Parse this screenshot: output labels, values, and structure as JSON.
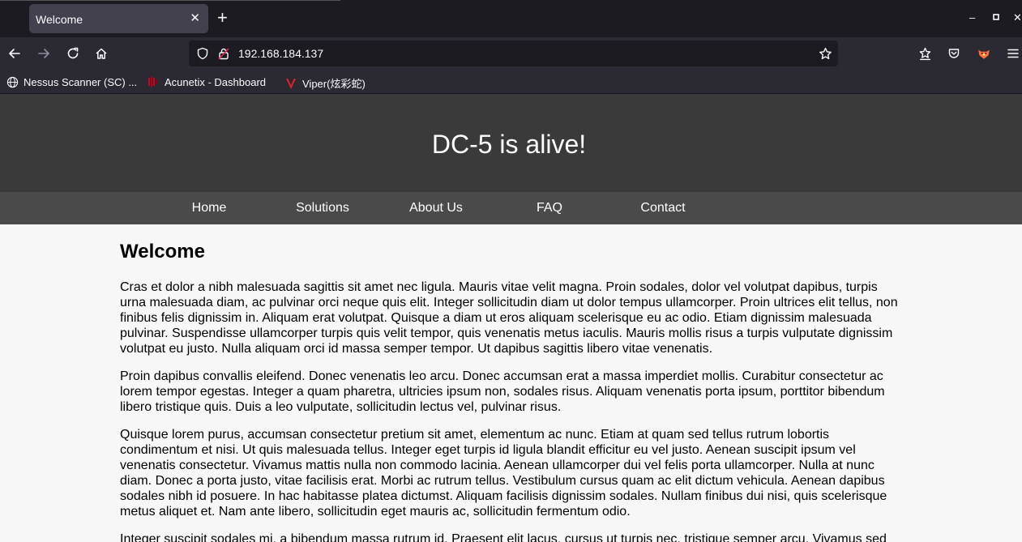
{
  "browser": {
    "tab": {
      "title": "Welcome",
      "close_glyph": "✕"
    },
    "new_tab_glyph": "+",
    "window_controls": {
      "minimize": "–",
      "maximize": "▫",
      "close": "✕"
    },
    "nav": {
      "back_icon": "arrow-left-icon",
      "forward_icon": "arrow-right-icon",
      "reload_icon": "reload-icon",
      "home_icon": "home-icon"
    },
    "urlbar": {
      "url": "192.168.184.137"
    },
    "bookmarks": [
      {
        "label": "Nessus Scanner (SC) ..."
      },
      {
        "label": "Acunetix - Dashboard"
      },
      {
        "label": "Viper(炫彩蛇)"
      }
    ],
    "colors": {
      "frame": "#1c1b22",
      "toolbar": "#2b2a33",
      "tab": "#42414d",
      "accent_firefox": "#ff7139"
    }
  },
  "site": {
    "title": "DC-5 is alive!",
    "nav": [
      {
        "label": "Home"
      },
      {
        "label": "Solutions"
      },
      {
        "label": "About Us"
      },
      {
        "label": "FAQ"
      },
      {
        "label": "Contact"
      }
    ],
    "heading": "Welcome",
    "paragraphs": [
      "Cras et dolor a nibh malesuada sagittis sit amet nec ligula. Mauris vitae velit magna. Proin sodales, dolor vel volutpat dapibus, turpis urna malesuada diam, ac pulvinar orci neque quis elit. Integer sollicitudin diam ut dolor tempus ullamcorper. Proin ultrices elit tellus, non finibus felis dignissim in. Aliquam erat volutpat. Quisque a diam ut eros aliquam scelerisque eu ac odio. Etiam dignissim malesuada pulvinar. Suspendisse ullamcorper turpis quis velit tempor, quis venenatis metus iaculis. Mauris mollis risus a turpis vulputate dignissim volutpat eu justo. Nulla aliquam orci id massa semper tempor. Ut dapibus sagittis libero vitae venenatis.",
      "Proin dapibus convallis eleifend. Donec venenatis leo arcu. Donec accumsan erat a massa imperdiet mollis. Curabitur consectetur ac lorem tempor egestas. Integer a quam pharetra, ultricies ipsum non, sodales risus. Aliquam venenatis porta ipsum, porttitor bibendum libero tristique quis. Duis a leo vulputate, sollicitudin lectus vel, pulvinar risus.",
      "Quisque lorem purus, accumsan consectetur pretium sit amet, elementum ac nunc. Etiam at quam sed tellus rutrum lobortis condimentum et nisi. Ut quis malesuada tellus. Integer eget turpis id ligula blandit efficitur eu vel justo. Aenean suscipit ipsum vel venenatis consectetur. Vivamus mattis nulla non commodo lacinia. Aenean ullamcorper dui vel felis porta ullamcorper. Nulla at nunc diam. Donec a porta justo, vitae facilisis erat. Morbi ac rutrum tellus. Vestibulum cursus quam ac elit dictum vehicula. Aenean dapibus sodales nibh id posuere. In hac habitasse platea dictumst. Aliquam facilisis dignissim sodales. Nullam finibus dui nisi, quis scelerisque metus aliquet et. Nam ante libero, sollicitudin eget mauris ac, sollicitudin fermentum odio.",
      "Integer suscipit sodales mi, a bibendum massa rutrum id. Praesent elit lacus, cursus ut turpis nec, tristique semper arcu. Vivamus sed"
    ],
    "colors": {
      "header": "#3a3a3a",
      "nav": "#4a4a4a",
      "body": "#f7f7f7"
    }
  }
}
